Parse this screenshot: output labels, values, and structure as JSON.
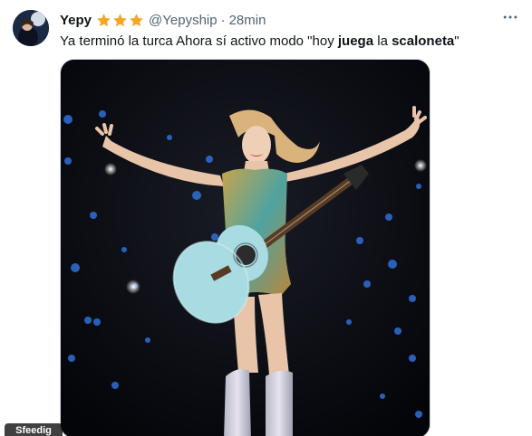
{
  "tweet": {
    "display_name": "Yepy",
    "star_count": 3,
    "star_color": "#f5a623",
    "handle": "@Yepyship",
    "separator": "·",
    "time": "28min",
    "text_parts": [
      {
        "text": "Ya terminó la turca Ahora sí activo modo \"hoy ",
        "bold": false
      },
      {
        "text": "juega",
        "bold": true
      },
      {
        "text": " la ",
        "bold": false
      },
      {
        "text": "scaloneta",
        "bold": true
      },
      {
        "text": "\"",
        "bold": false
      }
    ],
    "more_icon": "ellipsis-icon",
    "media_badge": "Sfeedig"
  },
  "colors": {
    "text_primary": "#0f1419",
    "text_secondary": "#536471",
    "media_background": "#07080d",
    "bokeh_blue": "#2f6fd8",
    "guitar": "#a9dbe2"
  }
}
